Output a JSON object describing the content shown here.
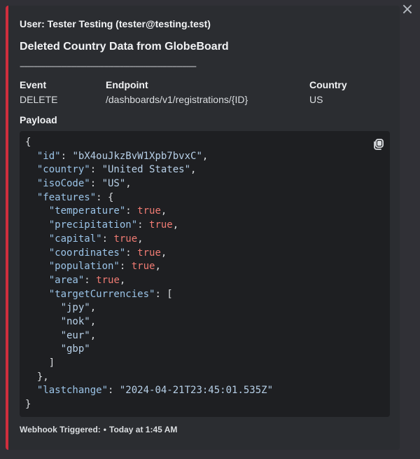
{
  "embed": {
    "accent_color": "#d02e3d",
    "author": "User: Tester Testing (tester@testing.test)",
    "title": "Deleted Country Data from GlobeBoard",
    "divider": "------------------------------------------------------------------------------------------",
    "fields": [
      {
        "name": "Event",
        "value": "DELETE"
      },
      {
        "name": "Endpoint",
        "value": "/dashboards/v1/registrations/{ID}"
      },
      {
        "name": "Country",
        "value": "US"
      }
    ],
    "payload_label": "Payload",
    "payload_lines": [
      [
        {
          "t": "{",
          "c": "p"
        }
      ],
      [
        {
          "t": "  ",
          "c": "p"
        },
        {
          "t": "\"id\"",
          "c": "k"
        },
        {
          "t": ": ",
          "c": "p"
        },
        {
          "t": "\"bX4ouJkzBvW1Xpb7bvxC\"",
          "c": "s"
        },
        {
          "t": ",",
          "c": "p"
        }
      ],
      [
        {
          "t": "  ",
          "c": "p"
        },
        {
          "t": "\"country\"",
          "c": "k"
        },
        {
          "t": ": ",
          "c": "p"
        },
        {
          "t": "\"United States\"",
          "c": "s"
        },
        {
          "t": ",",
          "c": "p"
        }
      ],
      [
        {
          "t": "  ",
          "c": "p"
        },
        {
          "t": "\"isoCode\"",
          "c": "k"
        },
        {
          "t": ": ",
          "c": "p"
        },
        {
          "t": "\"US\"",
          "c": "s"
        },
        {
          "t": ",",
          "c": "p"
        }
      ],
      [
        {
          "t": "  ",
          "c": "p"
        },
        {
          "t": "\"features\"",
          "c": "k"
        },
        {
          "t": ": {",
          "c": "p"
        }
      ],
      [
        {
          "t": "    ",
          "c": "p"
        },
        {
          "t": "\"temperature\"",
          "c": "k"
        },
        {
          "t": ": ",
          "c": "p"
        },
        {
          "t": "true",
          "c": "b"
        },
        {
          "t": ",",
          "c": "p"
        }
      ],
      [
        {
          "t": "    ",
          "c": "p"
        },
        {
          "t": "\"precipitation\"",
          "c": "k"
        },
        {
          "t": ": ",
          "c": "p"
        },
        {
          "t": "true",
          "c": "b"
        },
        {
          "t": ",",
          "c": "p"
        }
      ],
      [
        {
          "t": "    ",
          "c": "p"
        },
        {
          "t": "\"capital\"",
          "c": "k"
        },
        {
          "t": ": ",
          "c": "p"
        },
        {
          "t": "true",
          "c": "b"
        },
        {
          "t": ",",
          "c": "p"
        }
      ],
      [
        {
          "t": "    ",
          "c": "p"
        },
        {
          "t": "\"coordinates\"",
          "c": "k"
        },
        {
          "t": ": ",
          "c": "p"
        },
        {
          "t": "true",
          "c": "b"
        },
        {
          "t": ",",
          "c": "p"
        }
      ],
      [
        {
          "t": "    ",
          "c": "p"
        },
        {
          "t": "\"population\"",
          "c": "k"
        },
        {
          "t": ": ",
          "c": "p"
        },
        {
          "t": "true",
          "c": "b"
        },
        {
          "t": ",",
          "c": "p"
        }
      ],
      [
        {
          "t": "    ",
          "c": "p"
        },
        {
          "t": "\"area\"",
          "c": "k"
        },
        {
          "t": ": ",
          "c": "p"
        },
        {
          "t": "true",
          "c": "b"
        },
        {
          "t": ",",
          "c": "p"
        }
      ],
      [
        {
          "t": "    ",
          "c": "p"
        },
        {
          "t": "\"targetCurrencies\"",
          "c": "k"
        },
        {
          "t": ": [",
          "c": "p"
        }
      ],
      [
        {
          "t": "      ",
          "c": "p"
        },
        {
          "t": "\"jpy\"",
          "c": "s"
        },
        {
          "t": ",",
          "c": "p"
        }
      ],
      [
        {
          "t": "      ",
          "c": "p"
        },
        {
          "t": "\"nok\"",
          "c": "s"
        },
        {
          "t": ",",
          "c": "p"
        }
      ],
      [
        {
          "t": "      ",
          "c": "p"
        },
        {
          "t": "\"eur\"",
          "c": "s"
        },
        {
          "t": ",",
          "c": "p"
        }
      ],
      [
        {
          "t": "      ",
          "c": "p"
        },
        {
          "t": "\"gbp\"",
          "c": "s"
        }
      ],
      [
        {
          "t": "    ]",
          "c": "p"
        }
      ],
      [
        {
          "t": "  },",
          "c": "p"
        }
      ],
      [
        {
          "t": "  ",
          "c": "p"
        },
        {
          "t": "\"lastchange\"",
          "c": "k"
        },
        {
          "t": ": ",
          "c": "p"
        },
        {
          "t": "\"2024-04-21T23:45:01.535Z\"",
          "c": "s"
        }
      ],
      [
        {
          "t": "}",
          "c": "p"
        }
      ]
    ],
    "footer": {
      "text": "Webhook Triggered:",
      "separator": "•",
      "timestamp": "Today at 1:45 AM"
    }
  },
  "icons": {
    "close": "close-icon",
    "copy": "copy-icon"
  }
}
